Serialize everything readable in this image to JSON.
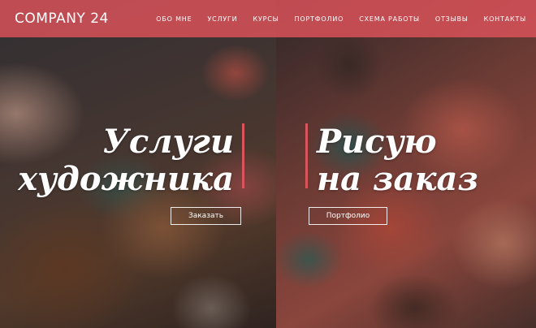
{
  "header": {
    "logo": "COMPANY 24",
    "nav": [
      "ОБО МНЕ",
      "УСЛУГИ",
      "КУРСЫ",
      "ПОРТФОЛИО",
      "СХЕМА РАБОТЫ",
      "ОТЗЫВЫ",
      "КОНТАКТЫ"
    ]
  },
  "hero_left": {
    "title_line1": "Услуги",
    "title_line2": "художника",
    "button": "Заказать"
  },
  "hero_right": {
    "title_line1": "Рисую",
    "title_line2": "на заказ",
    "button": "Портфолио"
  },
  "colors": {
    "accent": "#d9545c",
    "header_bg": "#d75258",
    "text": "#ffffff"
  }
}
